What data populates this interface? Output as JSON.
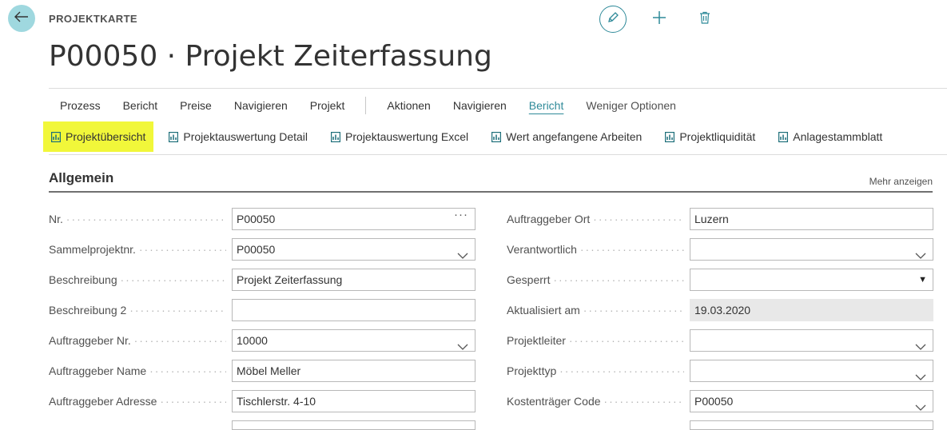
{
  "header": {
    "caption": "PROJEKTKARTE",
    "title": "P00050 · Projekt Zeiterfassung"
  },
  "menu": {
    "group1": [
      "Prozess",
      "Bericht",
      "Preise",
      "Navigieren",
      "Projekt"
    ],
    "group2": [
      "Aktionen",
      "Navigieren",
      "Bericht",
      "Weniger Optionen"
    ],
    "active": "Bericht"
  },
  "reports": [
    {
      "label": "Projektübersicht",
      "highlighted": true
    },
    {
      "label": "Projektauswertung Detail"
    },
    {
      "label": "Projektauswertung Excel"
    },
    {
      "label": "Wert angefangene Arbeiten"
    },
    {
      "label": "Projektliquidität"
    },
    {
      "label": "Anlagestammblatt"
    }
  ],
  "section": {
    "title": "Allgemein",
    "more_label": "Mehr anzeigen"
  },
  "fields_left": [
    {
      "label": "Nr.",
      "value": "P00050",
      "control": "ellipsis"
    },
    {
      "label": "Sammelprojektnr.",
      "value": "P00050",
      "control": "chevron"
    },
    {
      "label": "Beschreibung",
      "value": "Projekt Zeiterfassung",
      "control": "text"
    },
    {
      "label": "Beschreibung 2",
      "value": "",
      "control": "text"
    },
    {
      "label": "Auftraggeber Nr.",
      "value": "10000",
      "control": "chevron"
    },
    {
      "label": "Auftraggeber Name",
      "value": "Möbel Meller",
      "control": "text"
    },
    {
      "label": "Auftraggeber Adresse",
      "value": "Tischlerstr. 4-10",
      "control": "text"
    }
  ],
  "fields_right": [
    {
      "label": "Auftraggeber Ort",
      "value": "Luzern",
      "control": "text"
    },
    {
      "label": "Verantwortlich",
      "value": "",
      "control": "chevron"
    },
    {
      "label": "Gesperrt",
      "value": "",
      "control": "dropdown"
    },
    {
      "label": "Aktualisiert am",
      "value": "19.03.2020",
      "control": "readonly"
    },
    {
      "label": "Projektleiter",
      "value": "",
      "control": "chevron"
    },
    {
      "label": "Projekttyp",
      "value": "",
      "control": "chevron"
    },
    {
      "label": "Kostenträger Code",
      "value": "P00050",
      "control": "chevron"
    }
  ],
  "colors": {
    "accent": "#2f8a99",
    "back_button": "#9fd8df",
    "highlight": "#f1f73a",
    "report_icon": "#1d6f7a"
  },
  "icons": {
    "back": "arrow-left-icon",
    "edit": "pencil-icon",
    "add": "plus-icon",
    "delete": "trash-icon",
    "report": "report-chart-icon",
    "lookup": "ellipsis-icon",
    "dropdown": "chevron-down-icon"
  }
}
